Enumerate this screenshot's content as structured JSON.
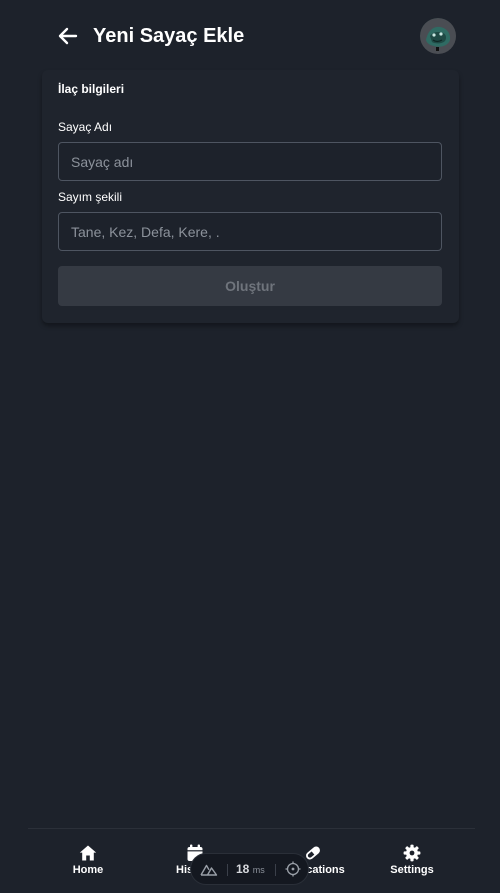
{
  "header": {
    "title": "Yeni Sayaç Ekle"
  },
  "form": {
    "section_title": "İlaç bilgileri",
    "name_label": "Sayaç Adı",
    "name_placeholder": "Sayaç adı",
    "name_value": "",
    "unit_label": "Sayım şekili",
    "unit_placeholder": "Tane, Kez, Defa, Kere, .",
    "unit_value": "",
    "submit_label": "Oluştur",
    "submit_disabled": true
  },
  "bottom_nav": {
    "items": [
      {
        "label": "Home",
        "icon": "home-icon"
      },
      {
        "label": "History",
        "icon": "calendar-icon"
      },
      {
        "label": "Medications",
        "icon": "pill-icon"
      },
      {
        "label": "Settings",
        "icon": "gear-icon"
      }
    ]
  },
  "devtools": {
    "value": "18",
    "unit": "ms"
  },
  "colors": {
    "background": "#1d222b",
    "card": "#1f242d",
    "input_border": "#4e5561",
    "button_disabled": "#353a43",
    "text": "#ffffff",
    "placeholder": "#8c929b"
  }
}
